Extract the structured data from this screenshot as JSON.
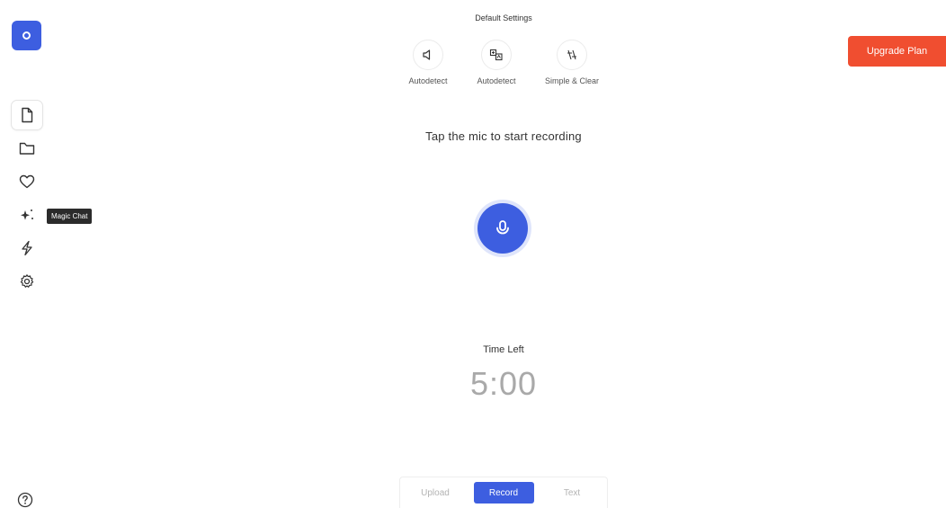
{
  "sidebar": {
    "logo": "app-logo",
    "items": [
      {
        "name": "document",
        "icon": "document-icon",
        "active": true
      },
      {
        "name": "folder",
        "icon": "folder-icon",
        "active": false
      },
      {
        "name": "favorites",
        "icon": "heart-icon",
        "active": false
      },
      {
        "name": "magic-chat",
        "icon": "sparkle-icon",
        "active": false
      },
      {
        "name": "lightning",
        "icon": "lightning-icon",
        "active": false
      },
      {
        "name": "settings",
        "icon": "gear-icon",
        "active": false
      }
    ],
    "tooltip": "Magic Chat",
    "help_icon": "help-icon"
  },
  "header": {
    "settings_title": "Default Settings",
    "settings": [
      {
        "label": "Autodetect",
        "icon": "speaker-icon"
      },
      {
        "label": "Autodetect",
        "icon": "translate-icon"
      },
      {
        "label": "Simple & Clear",
        "icon": "style-icon"
      }
    ],
    "upgrade_label": "Upgrade Plan"
  },
  "main": {
    "prompt": "Tap the mic to start recording",
    "mic_icon": "microphone-icon",
    "time_label": "Time Left",
    "time_value": "5:00"
  },
  "modes": {
    "tabs": [
      {
        "label": "Upload",
        "active": false
      },
      {
        "label": "Record",
        "active": true
      },
      {
        "label": "Text",
        "active": false
      }
    ]
  },
  "colors": {
    "accent": "#3d5ee0",
    "upgrade": "#f04e30",
    "tooltip_bg": "#2b2b2b"
  }
}
